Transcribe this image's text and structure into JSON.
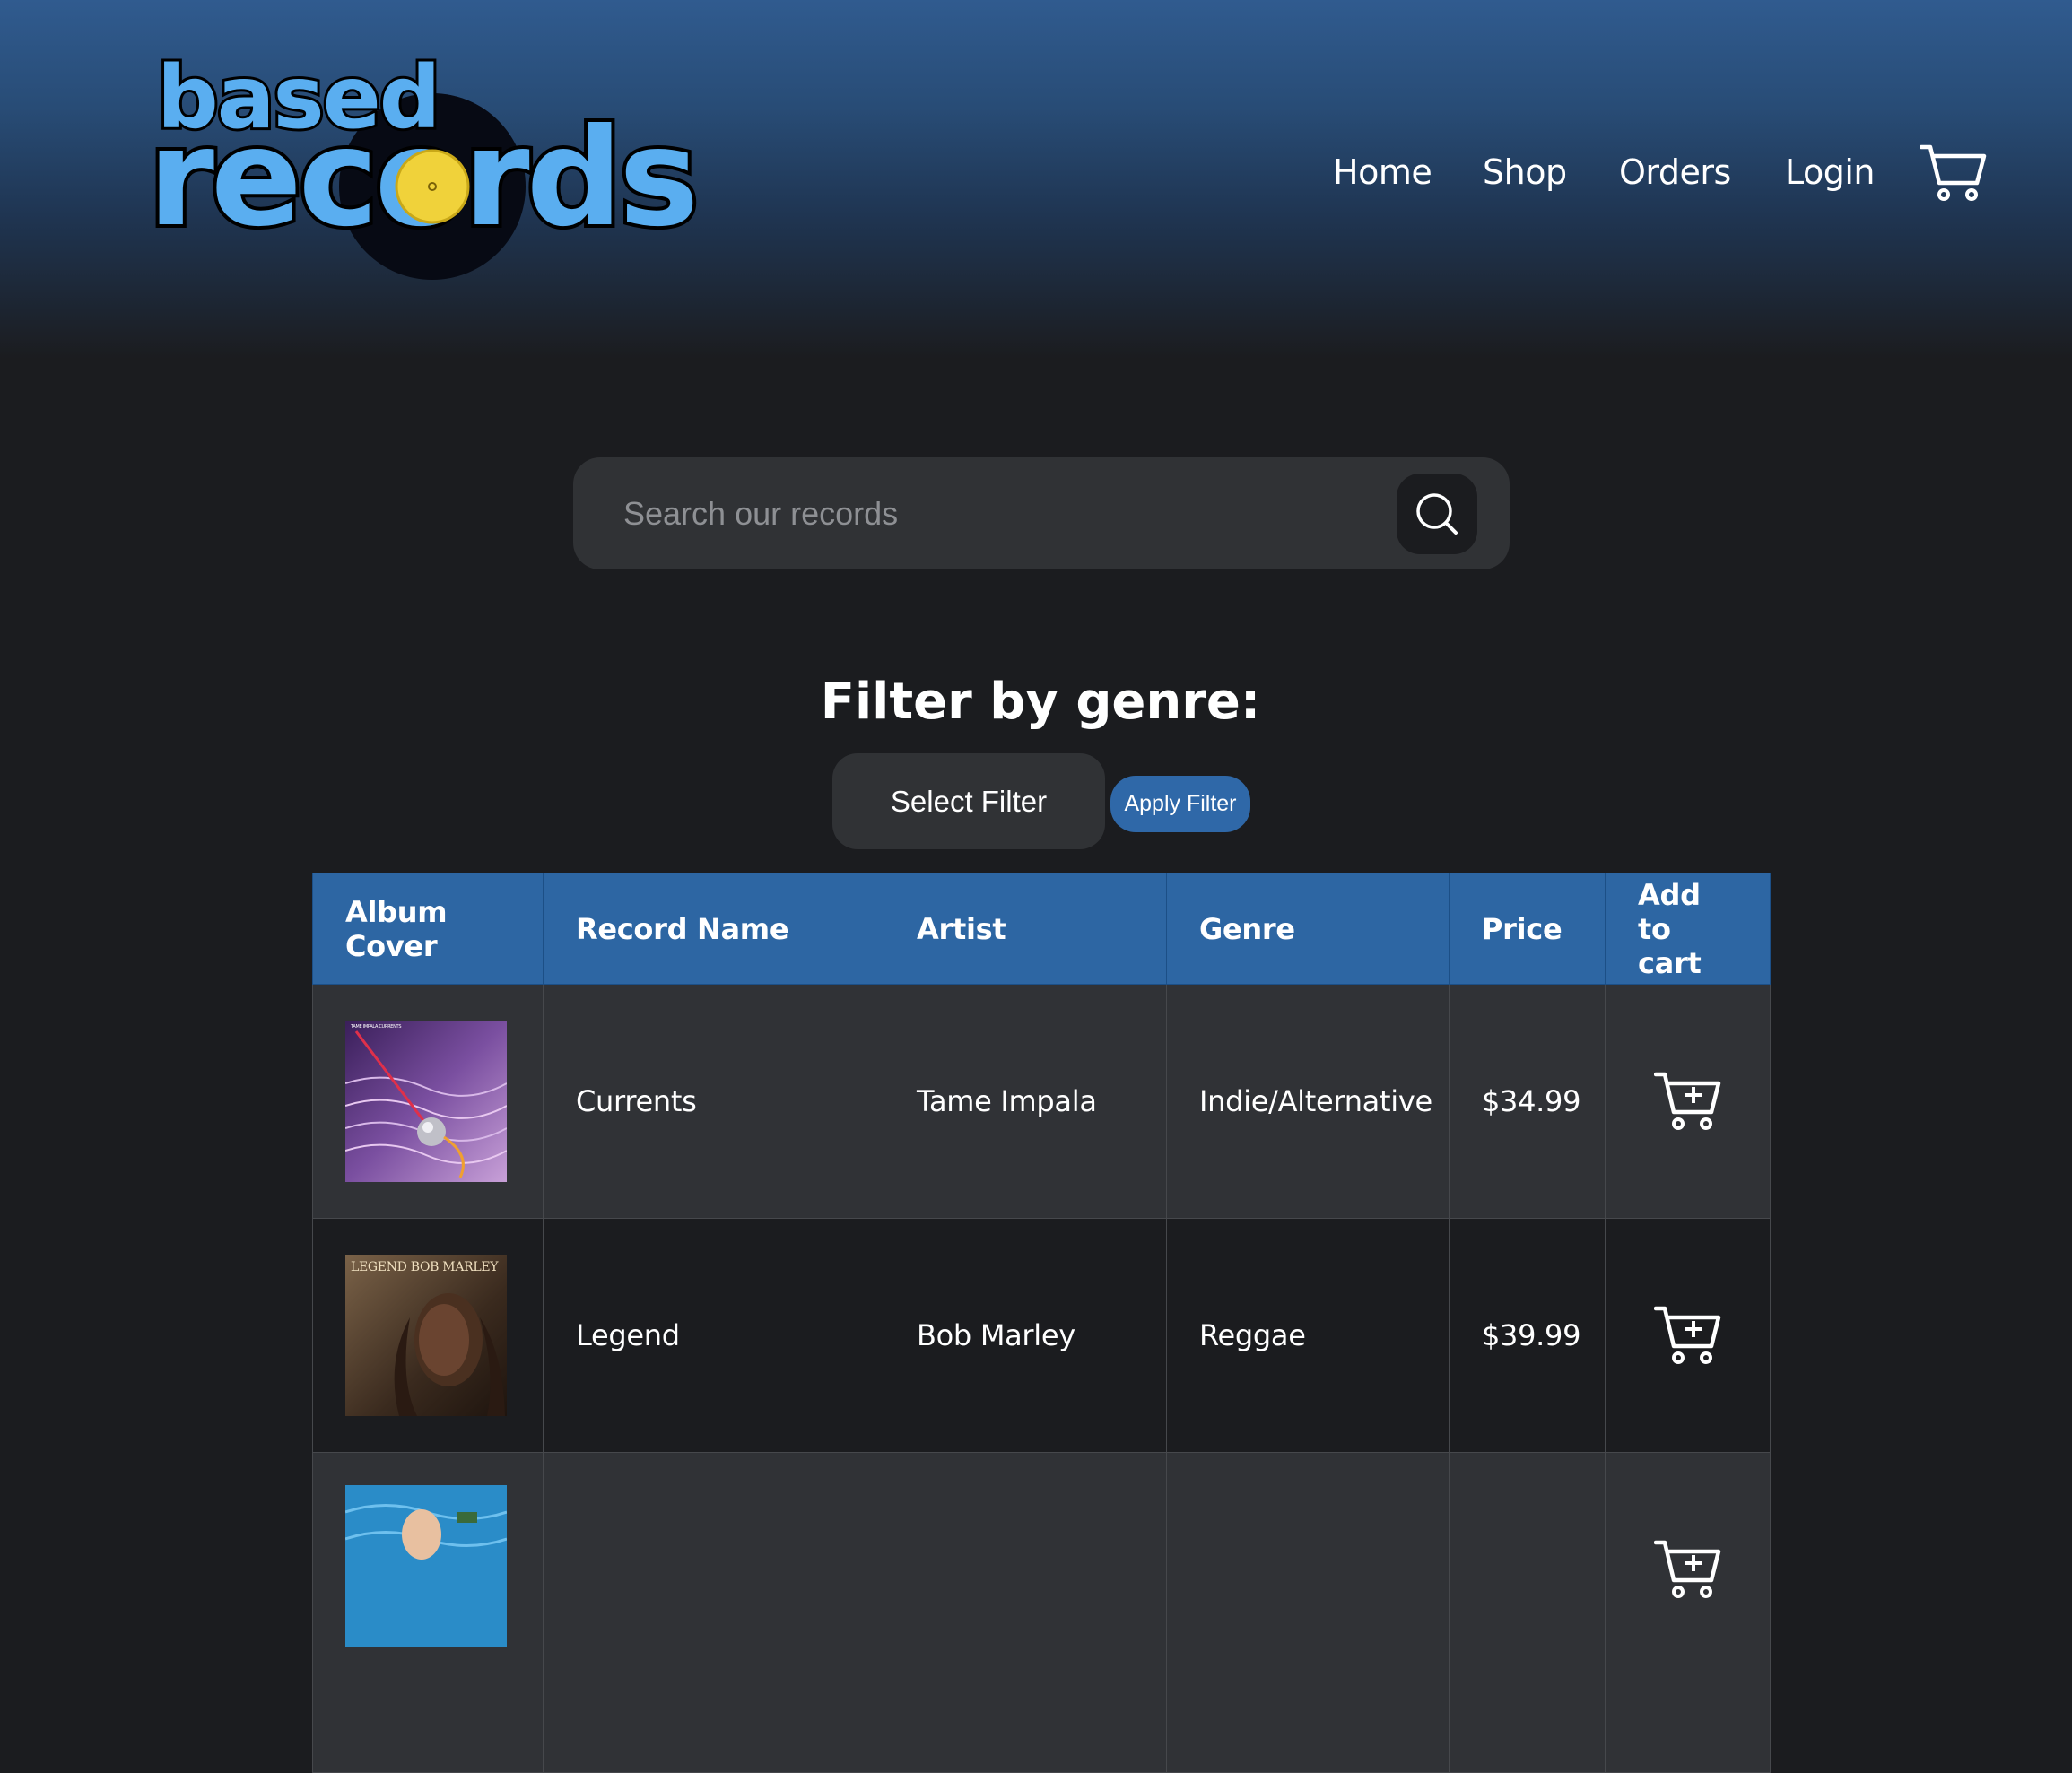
{
  "logo": {
    "top_word": "based",
    "bottom_word": "records"
  },
  "nav": {
    "items": [
      {
        "label": "Home"
      },
      {
        "label": "Shop"
      },
      {
        "label": "Orders"
      },
      {
        "label": "Login"
      }
    ],
    "cart_icon": "shopping-cart-icon"
  },
  "search": {
    "placeholder": "Search our records",
    "value": "",
    "icon": "search-icon"
  },
  "filter": {
    "title": "Filter by genre:",
    "select_label": "Select Filter",
    "apply_label": "Apply Filter"
  },
  "table": {
    "headers": [
      "Album Cover",
      "Record Name",
      "Artist",
      "Genre",
      "Price",
      "Add to cart"
    ],
    "rows": [
      {
        "record": "Currents",
        "artist": "Tame Impala",
        "genre": "Indie/Alternative",
        "price": "$34.99",
        "cover_text": "TAME IMPALA  CURRENTS"
      },
      {
        "record": "Legend",
        "artist": "Bob Marley",
        "genre": "Reggae",
        "price": "$39.99",
        "cover_text": "LEGEND BOB MARLEY"
      },
      {
        "record": "",
        "artist": "",
        "genre": "",
        "price": ""
      }
    ]
  },
  "colors": {
    "background": "#1b1c1f",
    "header_blue": "#305b8f",
    "table_header": "#2d66a3",
    "accent_button": "#2f68a8",
    "logo_blue": "#5aaef0",
    "record_label_yellow": "#f0d23a"
  }
}
